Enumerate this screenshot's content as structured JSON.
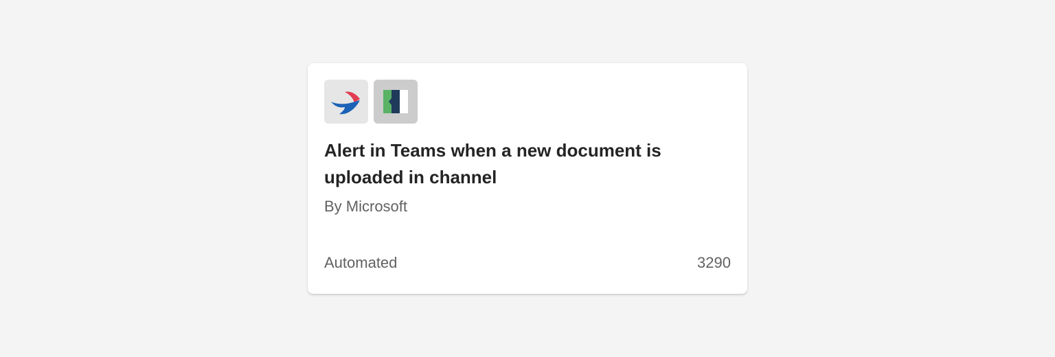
{
  "card": {
    "title": "Alert in Teams when a new document is uploaded in channel",
    "author": "By Microsoft",
    "type": "Automated",
    "count": "3290",
    "connectors": [
      {
        "icon": "kaizala-bird-icon",
        "tile_color": "#e6e6e6"
      },
      {
        "icon": "document-connector-icon",
        "tile_color": "#cccccc"
      }
    ]
  }
}
